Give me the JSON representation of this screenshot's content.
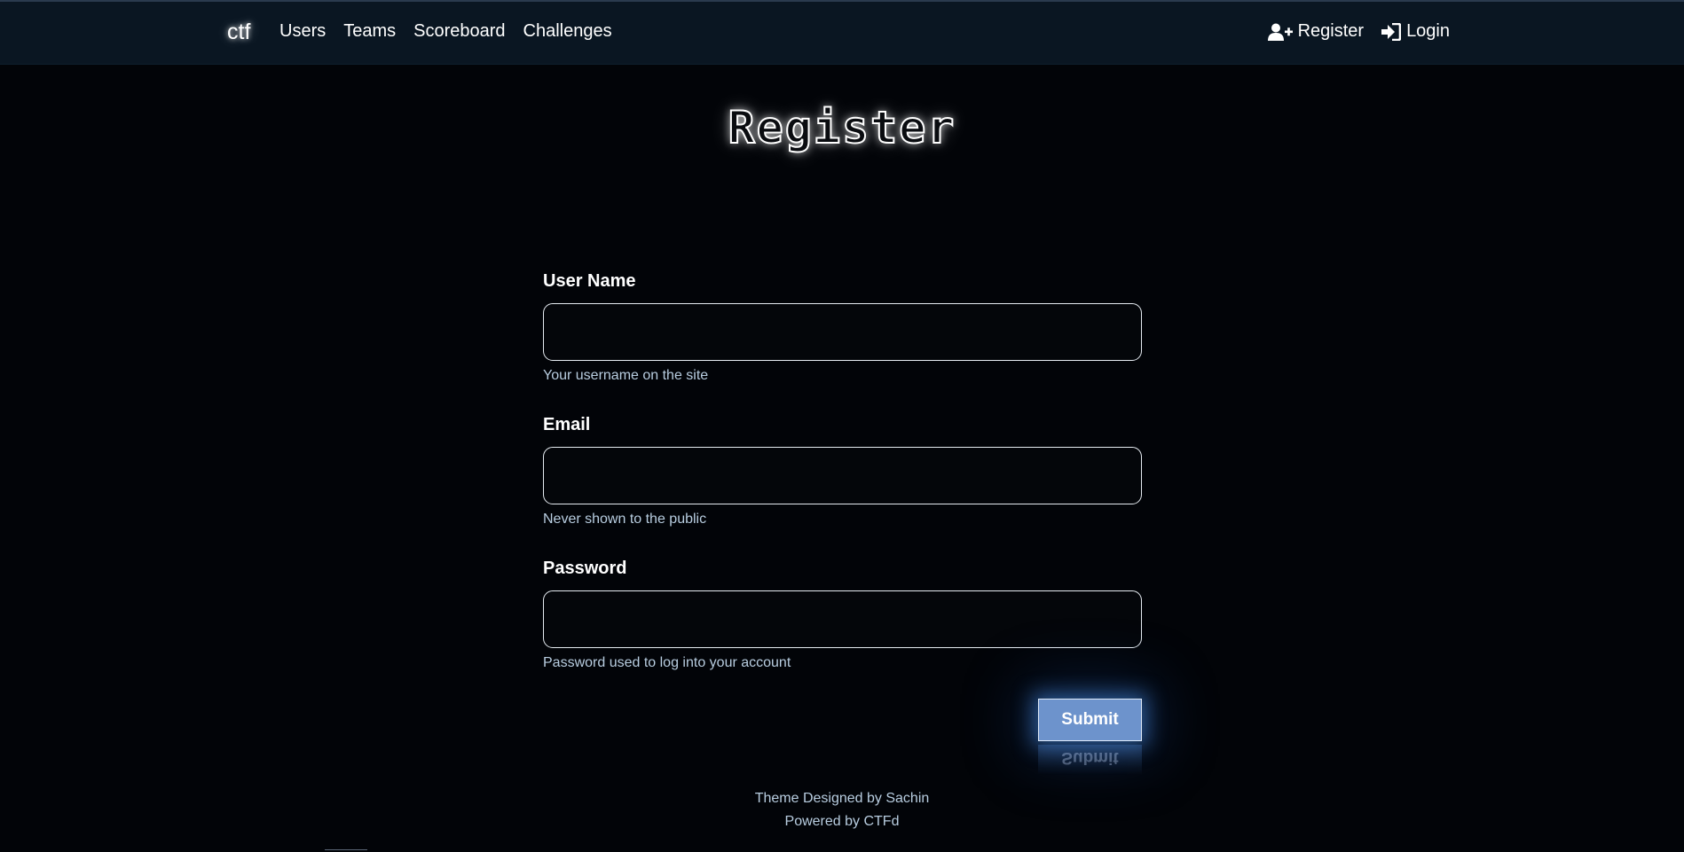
{
  "nav": {
    "brand": "ctf",
    "links": [
      "Users",
      "Teams",
      "Scoreboard",
      "Challenges"
    ],
    "register": "Register",
    "login": "Login",
    "register_icon": "user-plus-icon",
    "login_icon": "sign-in-icon"
  },
  "page": {
    "title": "Register"
  },
  "form": {
    "username": {
      "label": "User Name",
      "value": "",
      "help": "Your username on the site"
    },
    "email": {
      "label": "Email",
      "value": "",
      "help": "Never shown to the public"
    },
    "password": {
      "label": "Password",
      "value": "",
      "help": "Password used to log into your account"
    },
    "submit": "Submit"
  },
  "footer": {
    "line1": "Theme Designed by Sachin",
    "line2": "Powered by CTFd"
  },
  "colors": {
    "background": "#020408",
    "navbar": "#0a1622",
    "button": "#6d93cc",
    "help_text": "#b8cde0"
  }
}
